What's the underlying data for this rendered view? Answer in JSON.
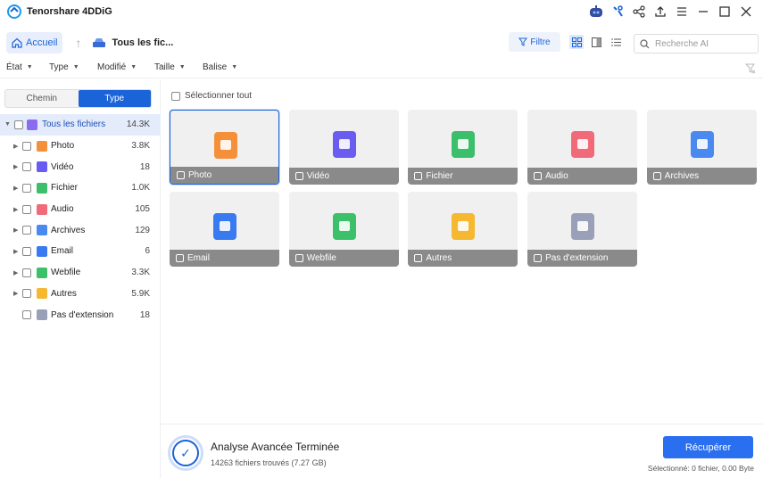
{
  "app": {
    "title": "Tenorshare 4DDiG"
  },
  "nav": {
    "home_label": "Accueil",
    "breadcrumb": "Tous les fic...",
    "filter_label": "Filtre",
    "search_placeholder": "Recherche AI"
  },
  "filters": [
    {
      "label": "État"
    },
    {
      "label": "Type"
    },
    {
      "label": "Modifié"
    },
    {
      "label": "Taille"
    },
    {
      "label": "Balise"
    }
  ],
  "sidebar": {
    "tabs": [
      {
        "label": "Chemin"
      },
      {
        "label": "Type"
      }
    ],
    "active_tab": "Type",
    "items": [
      {
        "label": "Tous les fichiers",
        "count": "14.3K",
        "color": "#8a6cf0"
      },
      {
        "label": "Photo",
        "count": "3.8K",
        "color": "#f5903a"
      },
      {
        "label": "Vidéo",
        "count": "18",
        "color": "#6a5cf0"
      },
      {
        "label": "Fichier",
        "count": "1.0K",
        "color": "#3cbf6a"
      },
      {
        "label": "Audio",
        "count": "105",
        "color": "#f06a7a"
      },
      {
        "label": "Archives",
        "count": "129",
        "color": "#4a8af0"
      },
      {
        "label": "Email",
        "count": "6",
        "color": "#3a7af0"
      },
      {
        "label": "Webfile",
        "count": "3.3K",
        "color": "#3cc06a"
      },
      {
        "label": "Autres",
        "count": "5.9K",
        "color": "#f5b830"
      },
      {
        "label": "Pas d'extension",
        "count": "18",
        "color": "#9aa0b8"
      }
    ]
  },
  "main": {
    "select_all_label": "Sélectionner tout",
    "tiles": [
      {
        "label": "Photo",
        "color": "#f5903a"
      },
      {
        "label": "Vidéo",
        "color": "#6a5cf0"
      },
      {
        "label": "Fichier",
        "color": "#3cbf6a"
      },
      {
        "label": "Audio",
        "color": "#f06a7a"
      },
      {
        "label": "Archives",
        "color": "#4a8af0"
      },
      {
        "label": "Email",
        "color": "#3a7af0"
      },
      {
        "label": "Webfile",
        "color": "#3cc06a"
      },
      {
        "label": "Autres",
        "color": "#f5b830"
      },
      {
        "label": "Pas d'extension",
        "color": "#9aa0b8"
      }
    ]
  },
  "footer": {
    "title": "Analyse Avancée Terminée",
    "subtitle": "14263 fichiers trouvés (7.27 GB)",
    "recover_label": "Récupérer",
    "selection_info": "Sélectionné: 0 fichier, 0.00 Byte"
  },
  "colors": {
    "accent": "#1a63d8",
    "button": "#2a6ff0"
  }
}
